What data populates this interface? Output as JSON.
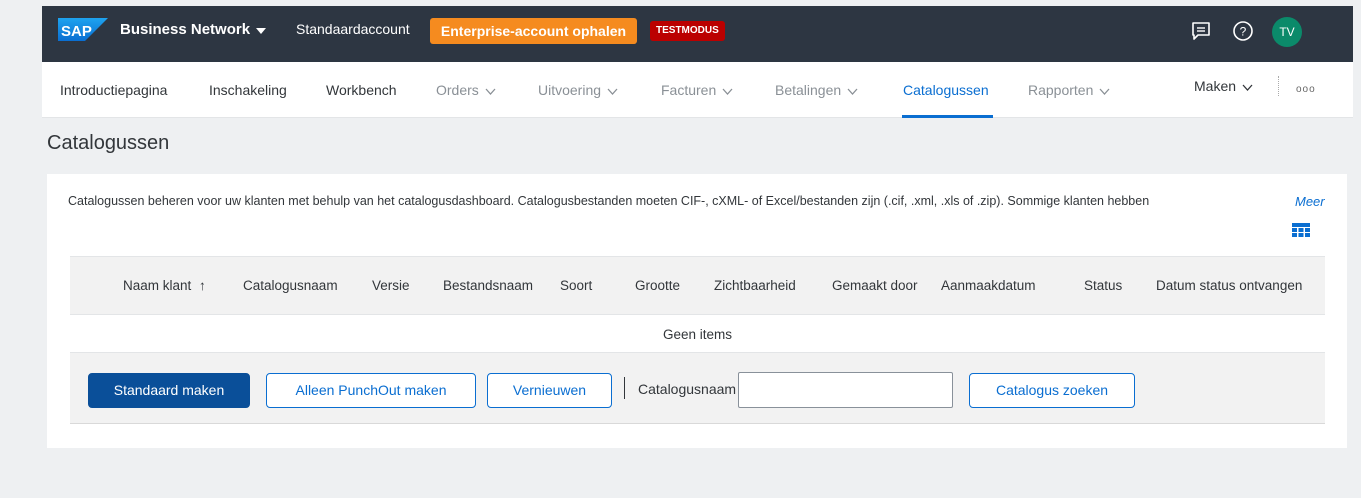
{
  "shell": {
    "logo_text": "SAP",
    "brand": "Business Network",
    "account": "Standaardaccount",
    "enterprise_button": "Enterprise-account ophalen",
    "test_badge": "TESTMODUS",
    "avatar_initials": "TV",
    "icons": [
      "chat-icon",
      "help-icon"
    ],
    "colors": {
      "bar": "#2d3642",
      "accent": "#f58b1f",
      "badge": "#bb0000",
      "avatar": "#0b8a6a"
    }
  },
  "nav": {
    "items": [
      {
        "label": "Introductiepagina"
      },
      {
        "label": "Inschakeling"
      },
      {
        "label": "Workbench"
      },
      {
        "label": "Orders"
      },
      {
        "label": "Uitvoering"
      },
      {
        "label": "Facturen"
      },
      {
        "label": "Betalingen"
      },
      {
        "label": "Catalogussen"
      },
      {
        "label": "Rapporten"
      }
    ],
    "active": "Catalogussen",
    "create": "Maken",
    "more": "ooo"
  },
  "page": {
    "title": "Catalogussen",
    "description": "Catalogussen beheren voor uw klanten met behulp van het catalogusdashboard. Catalogusbestanden moeten CIF-, cXML- of Excel/bestanden zijn (.cif, .xml, .xls of .zip). Sommige klanten hebben",
    "more_link": "Meer"
  },
  "table": {
    "columns": [
      "Naam klant",
      "Catalogusnaam",
      "Versie",
      "Bestandsnaam",
      "Soort",
      "Grootte",
      "Zichtbaarheid",
      "Gemaakt door",
      "Aanmaakdatum",
      "Status",
      "Datum status ontvangen"
    ],
    "sort_indicator": "↑",
    "empty_text": "Geen items"
  },
  "toolbar": {
    "create_standard": "Standaard maken",
    "create_punchout": "Alleen PunchOut maken",
    "refresh": "Vernieuwen",
    "catalog_name_label": "Catalogusnaam",
    "catalog_name_value": "",
    "search": "Catalogus zoeken"
  }
}
